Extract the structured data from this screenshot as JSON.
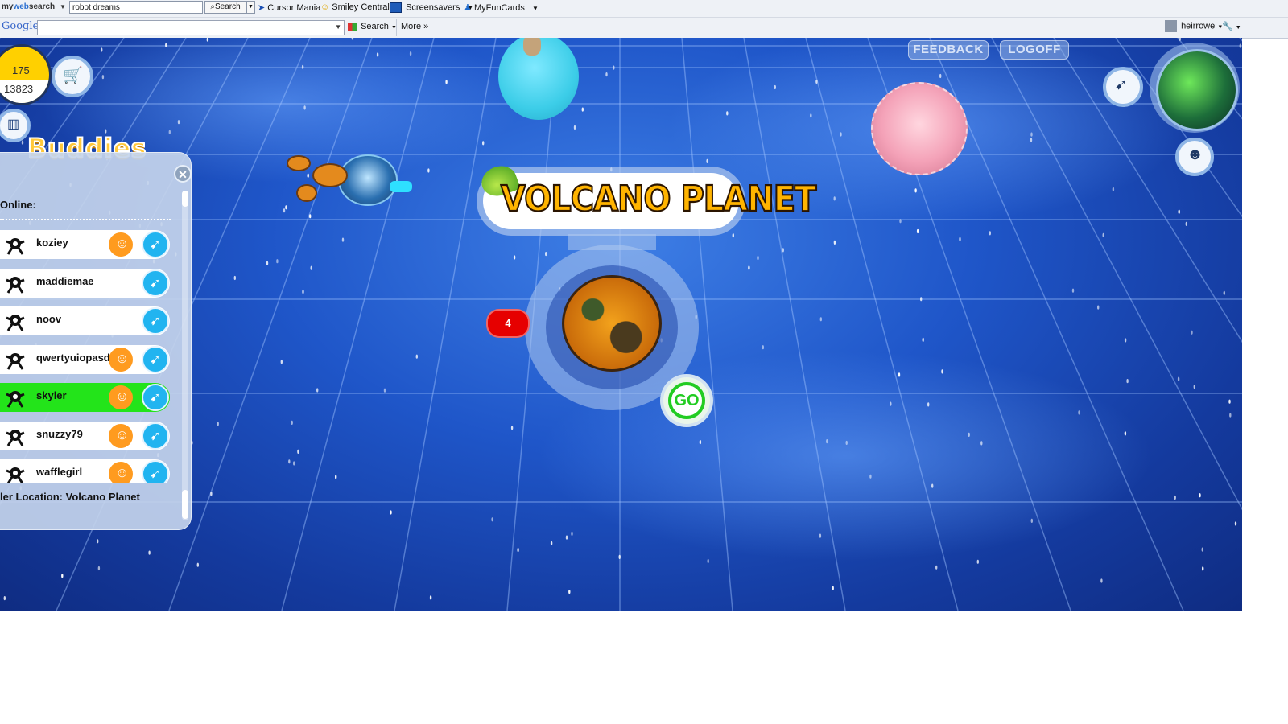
{
  "toolbar1": {
    "brand_prefix": "my",
    "brand_main": "web",
    "brand_suffix": "search",
    "search_value": "robot dreams",
    "search_button": "Search",
    "links": [
      "Cursor Mania",
      "Smiley Central",
      "Screensavers",
      "MyFunCards"
    ]
  },
  "toolbar2": {
    "google_logo": "Google",
    "search_label": "Search",
    "more_label": "More",
    "user": "heirrowe"
  },
  "game": {
    "coins": "175",
    "points": "13823",
    "feedback": "FEEDBACK",
    "logoff": "LOGOFF",
    "buddies_title": "Buddies",
    "online_label": "Online:",
    "buddies": [
      {
        "name": "koziey",
        "orange": true,
        "selected": false
      },
      {
        "name": "maddiemae",
        "orange": false,
        "selected": false
      },
      {
        "name": "noov",
        "orange": false,
        "selected": false
      },
      {
        "name": "qwertyuiopasd",
        "orange": true,
        "selected": false
      },
      {
        "name": "skyler",
        "orange": true,
        "selected": true
      },
      {
        "name": "snuzzy79",
        "orange": true,
        "selected": false
      },
      {
        "name": "wafflegirl",
        "orange": true,
        "selected": false
      }
    ],
    "location_text": "ler Location: Volcano Planet",
    "planet_title": "VOLCANO PLANET",
    "player_count": "4",
    "go_label": "GO",
    "colors": {
      "selected_row": "#23e41a",
      "title_fill": "#ffb400",
      "go_ring": "#22cc22",
      "badge": "#e60000"
    }
  }
}
